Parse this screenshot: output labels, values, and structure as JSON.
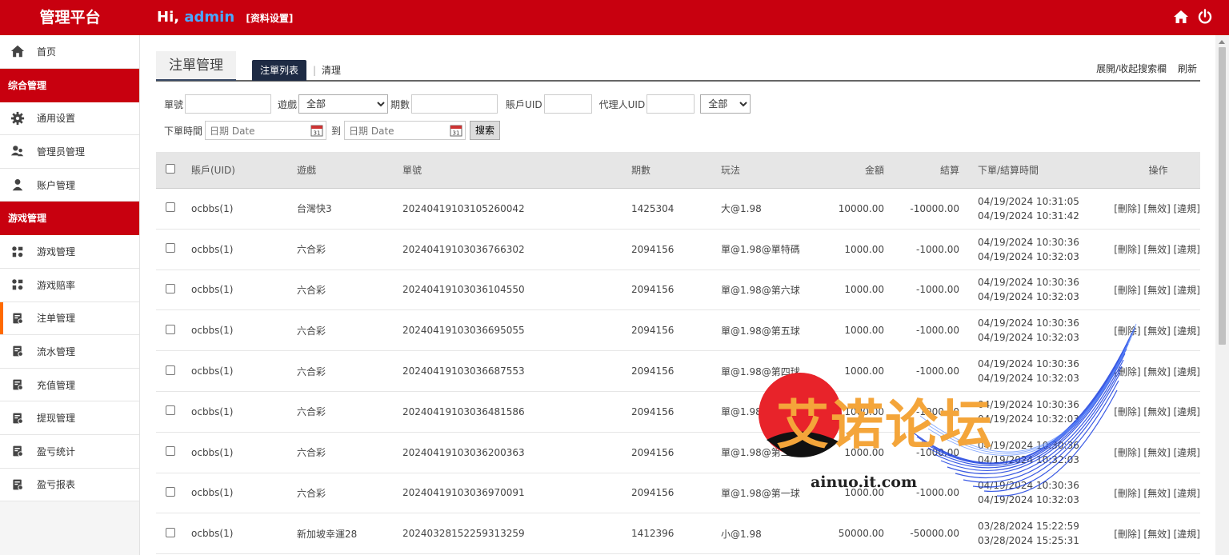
{
  "header": {
    "brand": "管理平台",
    "greeting_prefix": "Hi,",
    "username": "admin",
    "settings_link": "[资料设置]",
    "icons": [
      "home-icon",
      "power-icon"
    ]
  },
  "sidebar": {
    "home": {
      "label": "首页",
      "icon": "home-icon"
    },
    "sections": [
      {
        "title": "综合管理",
        "items": [
          {
            "label": "通用设置",
            "icon": "gear-icon"
          },
          {
            "label": "管理员管理",
            "icon": "users-icon"
          },
          {
            "label": "账户管理",
            "icon": "user-icon"
          }
        ]
      },
      {
        "title": "游戏管理",
        "items": [
          {
            "label": "游戏管理",
            "icon": "grid-icon"
          },
          {
            "label": "游戏赔率",
            "icon": "grid-icon"
          },
          {
            "label": "注单管理",
            "icon": "report-icon",
            "active": true
          },
          {
            "label": "流水管理",
            "icon": "report-icon"
          },
          {
            "label": "充值管理",
            "icon": "report-icon"
          },
          {
            "label": "提现管理",
            "icon": "report-icon"
          },
          {
            "label": "盈亏统计",
            "icon": "report-icon"
          },
          {
            "label": "盈亏报表",
            "icon": "report-icon"
          }
        ]
      }
    ]
  },
  "tabs": {
    "title": "注單管理",
    "active_tab": "注單列表",
    "separator": "|",
    "clear_tab": "清理",
    "toggle_search": "展開/收起搜索欄",
    "refresh": "刷新"
  },
  "search": {
    "order_no_label": "單號",
    "order_no_value": "",
    "game_label": "遊戲",
    "game_selected": "全部",
    "issue_label": "期數",
    "issue_value": "",
    "account_uid_label": "賬戶UID",
    "account_uid_value": "",
    "agent_uid_label": "代理人UID",
    "agent_uid_value": "",
    "status_selected": "全部",
    "order_time_label": "下單時間",
    "date_placeholder": "日期 Date",
    "to_label": "到",
    "search_button": "搜索"
  },
  "table": {
    "headers": {
      "account": "賬戶(UID)",
      "game": "遊戲",
      "order_no": "單號",
      "issue": "期數",
      "play": "玩法",
      "amount": "金額",
      "settle": "結算",
      "time": "下單/結算時間",
      "ops": "操作"
    },
    "ops": {
      "delete": "[刪除]",
      "void": "[無效]",
      "violation": "[違規]"
    },
    "rows": [
      {
        "account": "ocbbs(1)",
        "game": "台灣快3",
        "order_no": "20240419103105260042",
        "issue": "1425304",
        "play": "大@1.98",
        "amount": "10000.00",
        "settle": "-10000.00",
        "order_time": "04/19/2024 10:31:05",
        "settle_time": "04/19/2024 10:31:42"
      },
      {
        "account": "ocbbs(1)",
        "game": "六合彩",
        "order_no": "20240419103036766302",
        "issue": "2094156",
        "play": "單@1.98@單特碼",
        "amount": "1000.00",
        "settle": "-1000.00",
        "order_time": "04/19/2024 10:30:36",
        "settle_time": "04/19/2024 10:32:03"
      },
      {
        "account": "ocbbs(1)",
        "game": "六合彩",
        "order_no": "20240419103036104550",
        "issue": "2094156",
        "play": "單@1.98@第六球",
        "amount": "1000.00",
        "settle": "-1000.00",
        "order_time": "04/19/2024 10:30:36",
        "settle_time": "04/19/2024 10:32:03"
      },
      {
        "account": "ocbbs(1)",
        "game": "六合彩",
        "order_no": "20240419103036695055",
        "issue": "2094156",
        "play": "單@1.98@第五球",
        "amount": "1000.00",
        "settle": "-1000.00",
        "order_time": "04/19/2024 10:30:36",
        "settle_time": "04/19/2024 10:32:03"
      },
      {
        "account": "ocbbs(1)",
        "game": "六合彩",
        "order_no": "20240419103036687553",
        "issue": "2094156",
        "play": "單@1.98@第四球",
        "amount": "1000.00",
        "settle": "-1000.00",
        "order_time": "04/19/2024 10:30:36",
        "settle_time": "04/19/2024 10:32:03"
      },
      {
        "account": "ocbbs(1)",
        "game": "六合彩",
        "order_no": "20240419103036481586",
        "issue": "2094156",
        "play": "單@1.98@第三球",
        "amount": "1000.00",
        "settle": "-1000.00",
        "order_time": "04/19/2024 10:30:36",
        "settle_time": "04/19/2024 10:32:03"
      },
      {
        "account": "ocbbs(1)",
        "game": "六合彩",
        "order_no": "20240419103036200363",
        "issue": "2094156",
        "play": "單@1.98@第二球",
        "amount": "1000.00",
        "settle": "-1000.00",
        "order_time": "04/19/2024 10:30:36",
        "settle_time": "04/19/2024 10:32:03"
      },
      {
        "account": "ocbbs(1)",
        "game": "六合彩",
        "order_no": "20240419103036970091",
        "issue": "2094156",
        "play": "單@1.98@第一球",
        "amount": "1000.00",
        "settle": "-1000.00",
        "order_time": "04/19/2024 10:30:36",
        "settle_time": "04/19/2024 10:32:03"
      },
      {
        "account": "ocbbs(1)",
        "game": "新加坡幸運28",
        "order_no": "20240328152259313259",
        "issue": "1412396",
        "play": "小@1.98",
        "amount": "50000.00",
        "settle": "-50000.00",
        "order_time": "03/28/2024 15:22:59",
        "settle_time": "03/28/2024 15:25:31"
      }
    ]
  },
  "watermark": {
    "text": "艾诺论坛",
    "url": "ainuo.it.com"
  }
}
